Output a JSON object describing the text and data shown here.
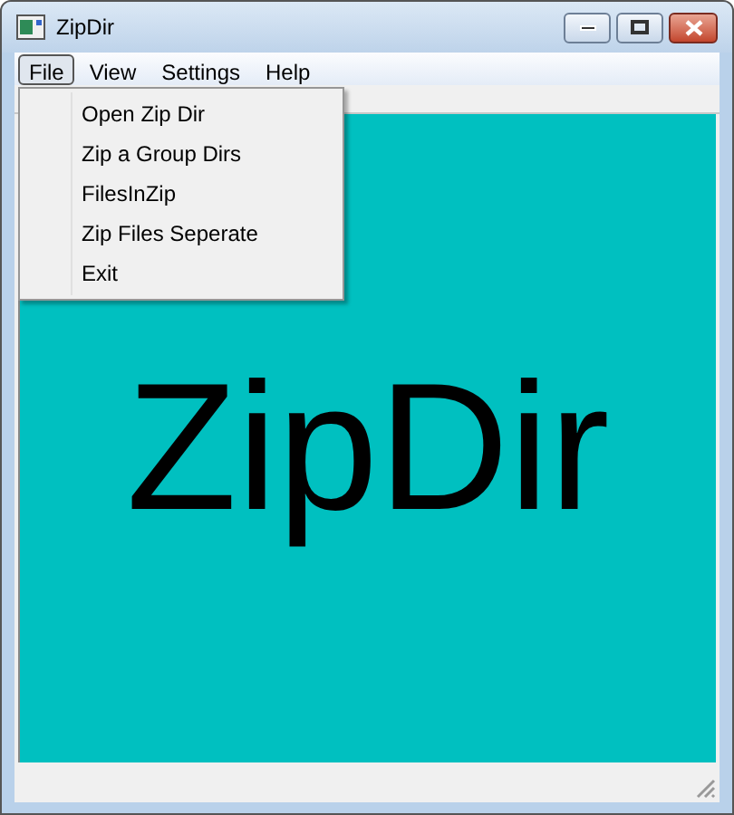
{
  "window": {
    "title": "ZipDir"
  },
  "menu_bar": [
    {
      "label": "File",
      "selected": true
    },
    {
      "label": "View",
      "selected": false
    },
    {
      "label": "Settings",
      "selected": false
    },
    {
      "label": "Help",
      "selected": false
    }
  ],
  "file_menu": [
    "Open Zip Dir",
    "Zip a Group Dirs",
    "FilesInZip",
    "Zip Files Seperate",
    "Exit"
  ],
  "banner": "ZipDir"
}
